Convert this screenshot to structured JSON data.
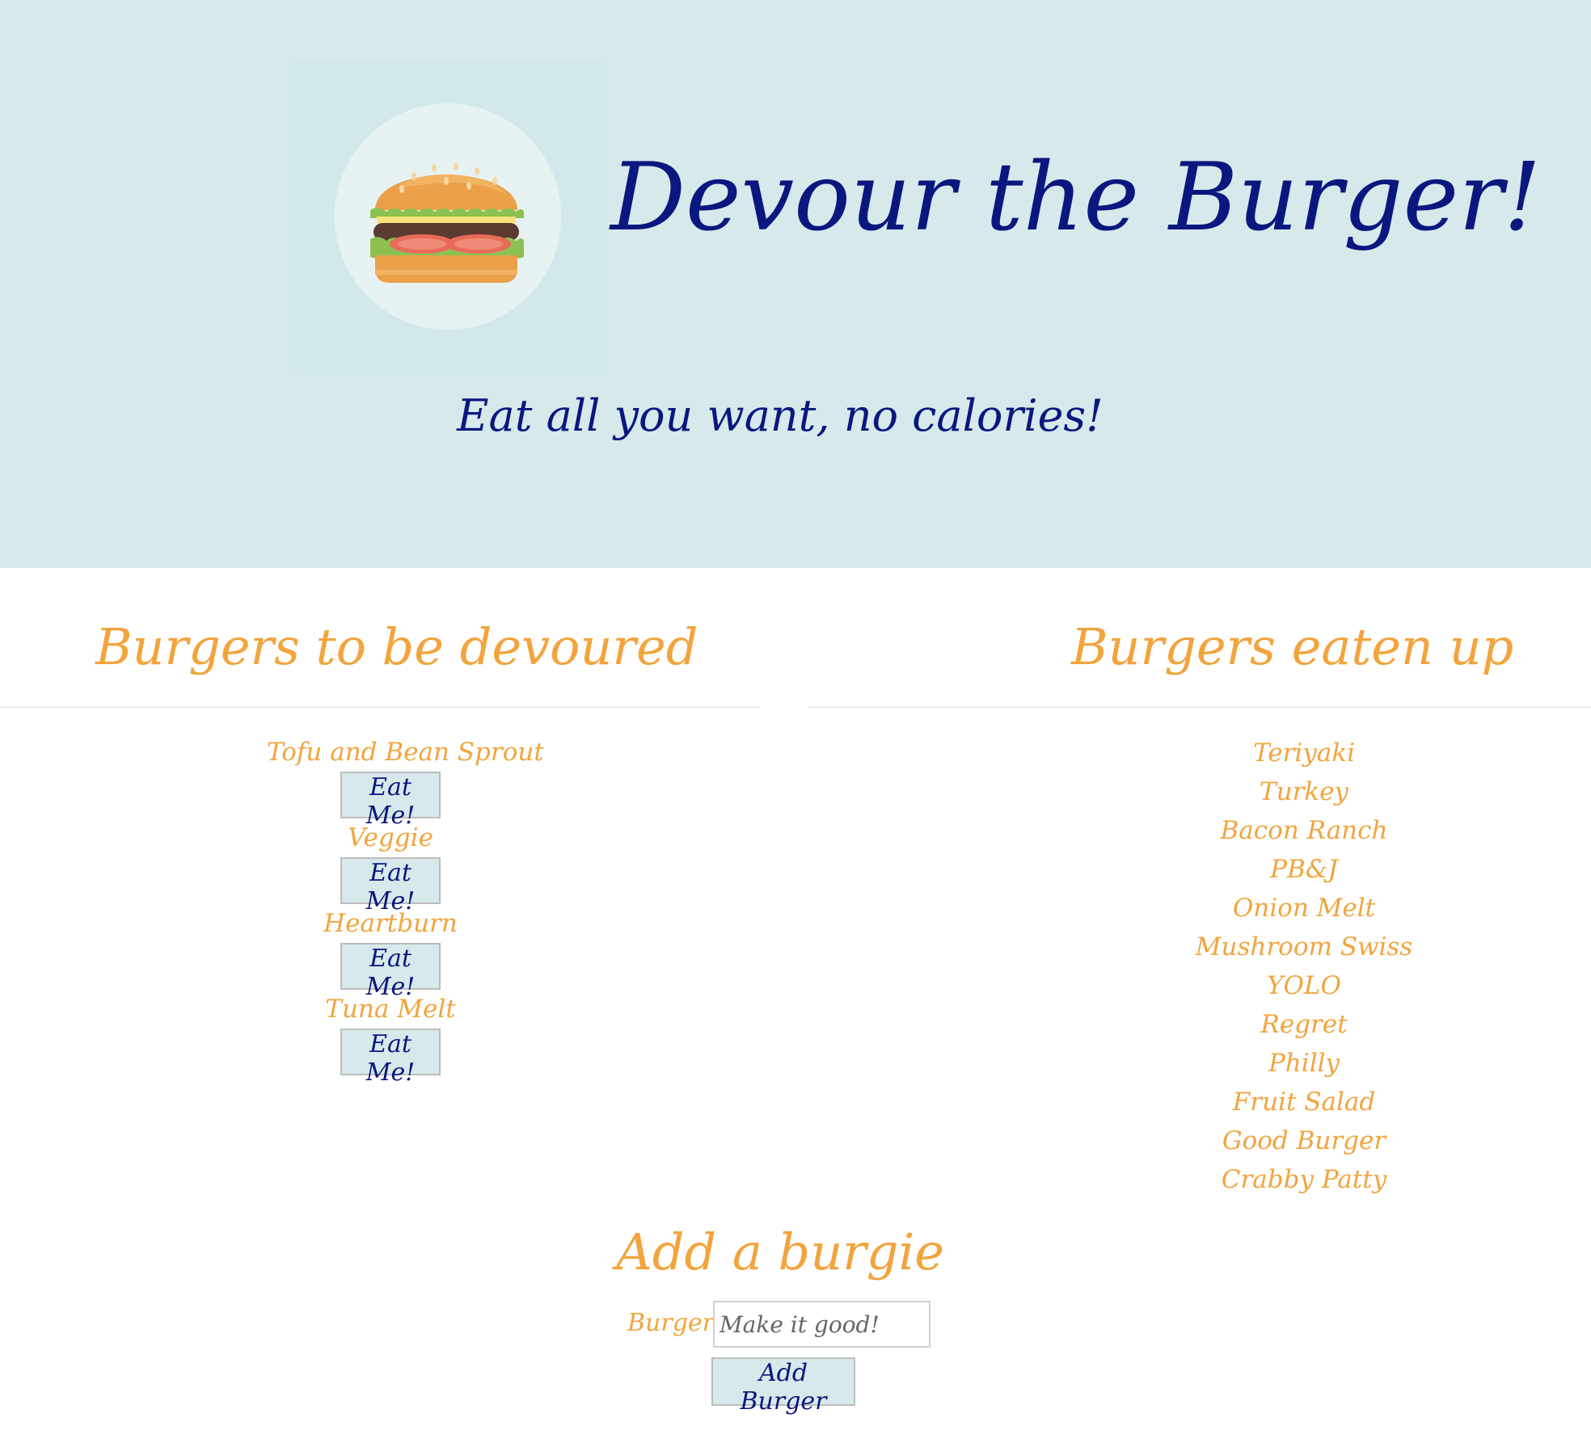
{
  "hero": {
    "title": "Devour the Burger!",
    "subtitle": "Eat all you want, no calories!",
    "logo_icon": "burger-icon"
  },
  "left_column": {
    "heading": "Burgers to be devoured",
    "items": [
      {
        "name": "Tofu and Bean Sprout",
        "button": "Eat Me!"
      },
      {
        "name": "Veggie",
        "button": "Eat Me!"
      },
      {
        "name": "Heartburn",
        "button": "Eat Me!"
      },
      {
        "name": "Tuna Melt",
        "button": "Eat Me!"
      }
    ]
  },
  "right_column": {
    "heading": "Burgers eaten up",
    "items": [
      "Teriyaki",
      "Turkey",
      "Bacon Ranch",
      "PB&J",
      "Onion Melt",
      "Mushroom Swiss",
      "YOLO",
      "Regret",
      "Philly",
      "Fruit Salad",
      "Good Burger",
      "Crabby Patty"
    ]
  },
  "add_form": {
    "heading": "Add a burgie",
    "label": "Burger:",
    "placeholder": "Make it good!",
    "value": "",
    "submit": "Add Burger"
  },
  "colors": {
    "hero_bg": "#d7e9ea",
    "navy": "#0a177f",
    "orange": "#f2a43d",
    "button_bg": "#d7e9ea"
  }
}
